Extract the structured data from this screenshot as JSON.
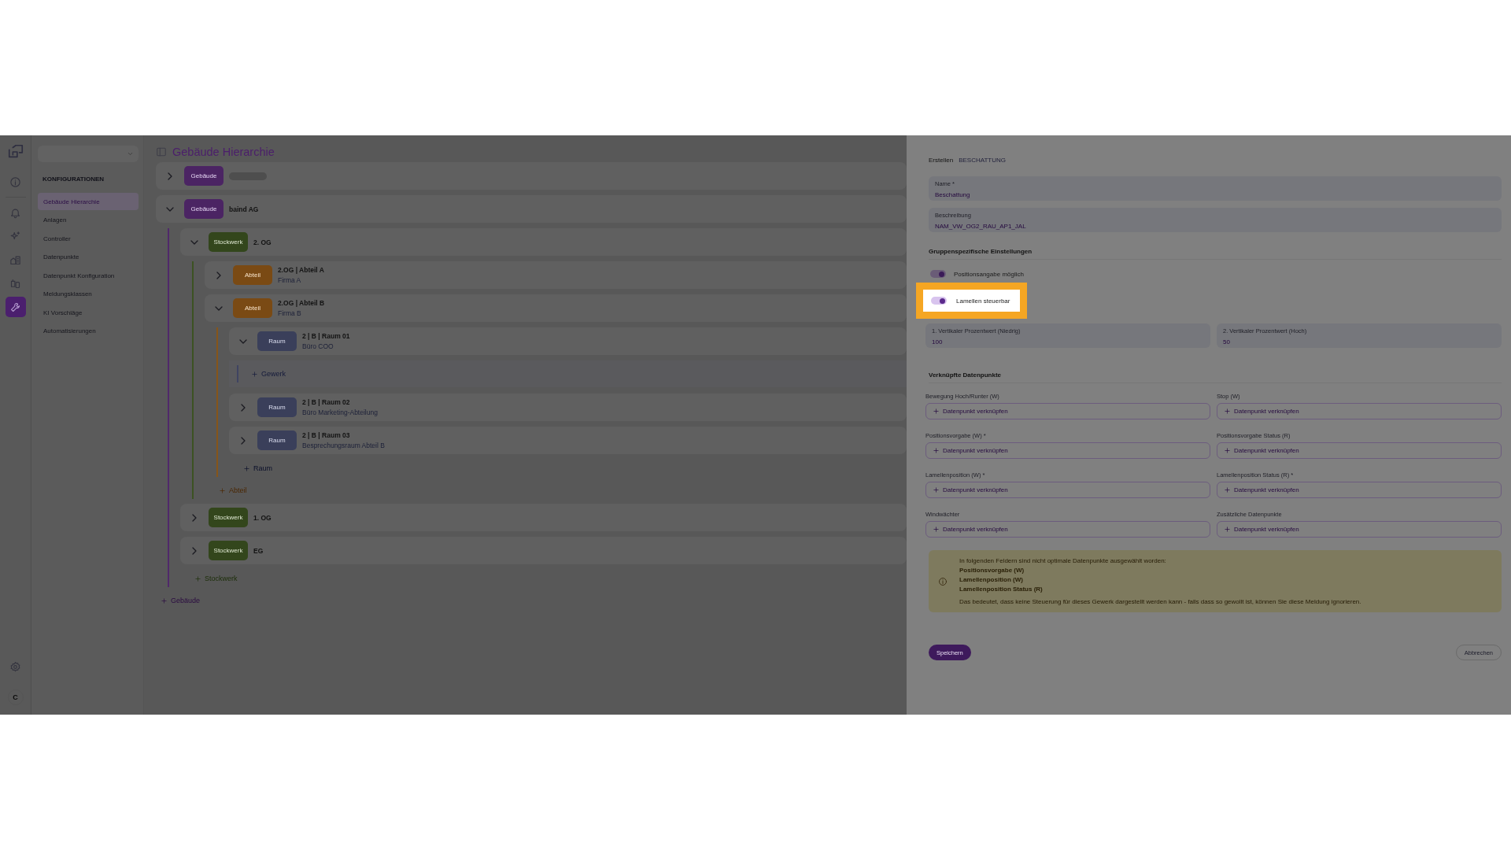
{
  "rail": {
    "items": [
      {
        "kind": "info",
        "selected": false
      },
      {
        "kind": "bell",
        "selected": false
      },
      {
        "kind": "sparkle",
        "selected": false
      },
      {
        "kind": "buildings",
        "selected": false
      },
      {
        "kind": "devices",
        "selected": false
      },
      {
        "kind": "wrench",
        "selected": true
      }
    ],
    "settings": {
      "kind": "settings",
      "selected": false
    },
    "avatar": "C"
  },
  "sidebar": {
    "heading": "KONFIGURATIONEN",
    "items": [
      {
        "label": "Gebäude Hierarchie",
        "selected": true
      },
      {
        "label": "Anlagen",
        "selected": false
      },
      {
        "label": "Controller",
        "selected": false
      },
      {
        "label": "Datenpunkte",
        "selected": false
      },
      {
        "label": "Datenpunkt Konfiguration",
        "selected": false
      },
      {
        "label": "Meldungsklassen",
        "selected": false
      },
      {
        "label": "KI Vorschläge",
        "selected": false
      },
      {
        "label": "Automatisierungen",
        "selected": false
      }
    ]
  },
  "page": {
    "title": "Gebäude Hierarchie"
  },
  "tree": {
    "nodes": [
      {
        "kind": "gebaeude",
        "badge": "Gebäude",
        "expanded": false
      },
      {
        "kind": "gebaeude",
        "badge": "Gebäude",
        "title": "baind AG",
        "expanded": true,
        "children": [
          {
            "kind": "stockwerk",
            "badge": "Stockwerk",
            "title": "2. OG",
            "expanded": true,
            "children": [
              {
                "kind": "abteil",
                "badge": "Abteil",
                "title": "2.OG | Abteil A",
                "subtitle": "Firma A",
                "expanded": false
              },
              {
                "kind": "abteil",
                "badge": "Abteil",
                "title": "2.OG | Abteil B",
                "subtitle": "Firma B",
                "expanded": true,
                "children": [
                  {
                    "kind": "raum",
                    "badge": "Raum",
                    "title": "2 | B | Raum 01",
                    "subtitle": "Büro COO",
                    "expanded": true,
                    "add": {
                      "kind": "gewerk",
                      "label": "Gewerk"
                    }
                  },
                  {
                    "kind": "raum",
                    "badge": "Raum",
                    "title": "2 | B | Raum 02",
                    "subtitle": "Büro Marketing-Abteilung",
                    "expanded": false
                  },
                  {
                    "kind": "raum",
                    "badge": "Raum",
                    "title": "2 | B | Raum 03",
                    "subtitle": "Besprechungsraum Abteil B",
                    "expanded": false
                  }
                ],
                "add": {
                  "kind": "raum",
                  "label": "Raum"
                }
              }
            ],
            "add": {
              "kind": "abteil",
              "label": "Abteil"
            }
          },
          {
            "kind": "stockwerk",
            "badge": "Stockwerk",
            "title": "1. OG",
            "expanded": false
          },
          {
            "kind": "stockwerk",
            "badge": "Stockwerk",
            "title": "EG",
            "expanded": false
          }
        ],
        "add": {
          "kind": "stockwerk",
          "label": "Stockwerk"
        }
      }
    ],
    "add": {
      "kind": "gebaeude",
      "label": "Gebäude"
    }
  },
  "drawer": {
    "breadcrumb": {
      "current": "Erstellen",
      "section": "BESCHATTUNG"
    },
    "fields": [
      {
        "label": "Name *",
        "value": "Beschattung"
      },
      {
        "label": "Beschreibung",
        "value": "NAM_VW_OG2_RAU_AP1_JAL"
      }
    ],
    "group_settings": {
      "heading": "Gruppenspezifische Einstellungen",
      "toggles": [
        {
          "label": "Positionsangabe möglich",
          "on": true,
          "highlighted": false
        },
        {
          "label": "Lamellen steuerbar",
          "on": true,
          "highlighted": true
        }
      ],
      "fields": [
        {
          "label": "1. Vertikaler Prozentwert (Niedrig)",
          "value": "100"
        },
        {
          "label": "2. Vertikaler Prozentwert (Hoch)",
          "value": "50"
        }
      ]
    },
    "linked": {
      "heading": "Verknüpfte Datenpunkte",
      "slots": [
        {
          "label": "Bewegung Hoch/Runter (W)",
          "button": "Datenpunkt verknüpfen"
        },
        {
          "label": "Stop (W)",
          "button": "Datenpunkt verknüpfen"
        },
        {
          "label": "Positionsvorgabe (W) *",
          "button": "Datenpunkt verknüpfen"
        },
        {
          "label": "Positionsvorgabe Status (R)",
          "button": "Datenpunkt verknüpfen"
        },
        {
          "label": "Lamellenposition (W) *",
          "button": "Datenpunkt verknüpfen"
        },
        {
          "label": "Lamellenposition Status (R) *",
          "button": "Datenpunkt verknüpfen"
        },
        {
          "label": "Windwächter",
          "button": "Datenpunkt verknüpfen"
        },
        {
          "label": "Zusätzliche Datenpunkte",
          "button": "Datenpunkt verknüpfen"
        }
      ]
    },
    "warning": {
      "intro": "In folgenden Feldern sind nicht optimale Datenpunkte ausgewählt worden:",
      "items": [
        "Positionsvorgabe (W)",
        "Lamellenposition (W)",
        "Lamellenposition Status (R)"
      ],
      "note": "Das bedeutet, dass keine Steuerung für dieses Gewerk dargestellt werden kann - falls dass so gewollt ist, können Sie diese Meldung ignorieren."
    },
    "actions": {
      "save": "Speichern",
      "cancel": "Abbrechen"
    }
  }
}
